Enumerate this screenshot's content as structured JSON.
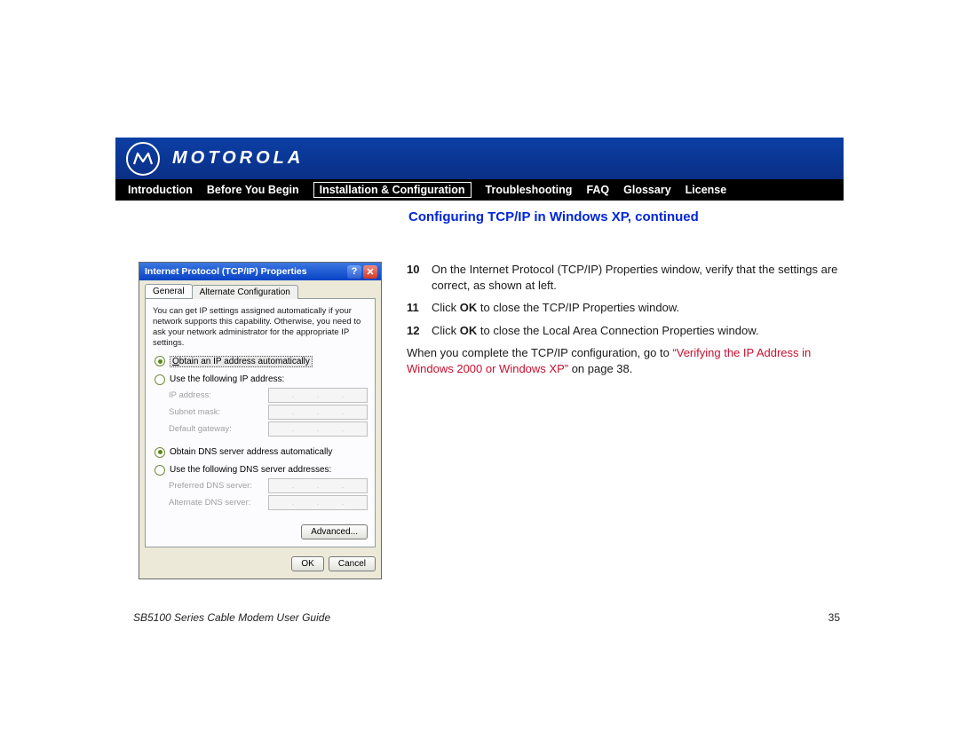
{
  "brand": "MOTOROLA",
  "nav": {
    "items": [
      "Introduction",
      "Before You Begin",
      "Installation & Configuration",
      "Troubleshooting",
      "FAQ",
      "Glossary",
      "License"
    ],
    "active_index": 2
  },
  "heading": "Configuring TCP/IP in Windows XP, continued",
  "dialog": {
    "title": "Internet Protocol (TCP/IP) Properties",
    "tabs": [
      "General",
      "Alternate Configuration"
    ],
    "desc": "You can get IP settings assigned automatically if your network supports this capability. Otherwise, you need to ask your network administrator for the appropriate IP settings.",
    "radio_ip_auto": "Obtain an IP address automatically",
    "radio_ip_manual": "Use the following IP address:",
    "fld_ip": "IP address:",
    "fld_subnet": "Subnet mask:",
    "fld_gateway": "Default gateway:",
    "radio_dns_auto": "Obtain DNS server address automatically",
    "radio_dns_manual": "Use the following DNS server addresses:",
    "fld_dns1": "Preferred DNS server:",
    "fld_dns2": "Alternate DNS server:",
    "btn_advanced": "Advanced...",
    "btn_ok": "OK",
    "btn_cancel": "Cancel"
  },
  "steps": {
    "s10_num": "10",
    "s10_text": "On the Internet Protocol (TCP/IP) Properties window, verify that the settings are correct, as shown at left.",
    "s11_num": "11",
    "s11_a": "Click ",
    "s11_b": "OK",
    "s11_c": " to close the TCP/IP Properties window.",
    "s12_num": "12",
    "s12_a": "Click ",
    "s12_b": "OK",
    "s12_c": " to close the Local Area Connection Properties window.",
    "post_a": "When you complete the TCP/IP configuration, go to ",
    "post_link": "“Verifying the IP Address in Windows 2000 or Windows XP”",
    "post_b": " on page 38."
  },
  "footer": {
    "guide": "SB5100 Series Cable Modem User Guide",
    "page": "35"
  }
}
